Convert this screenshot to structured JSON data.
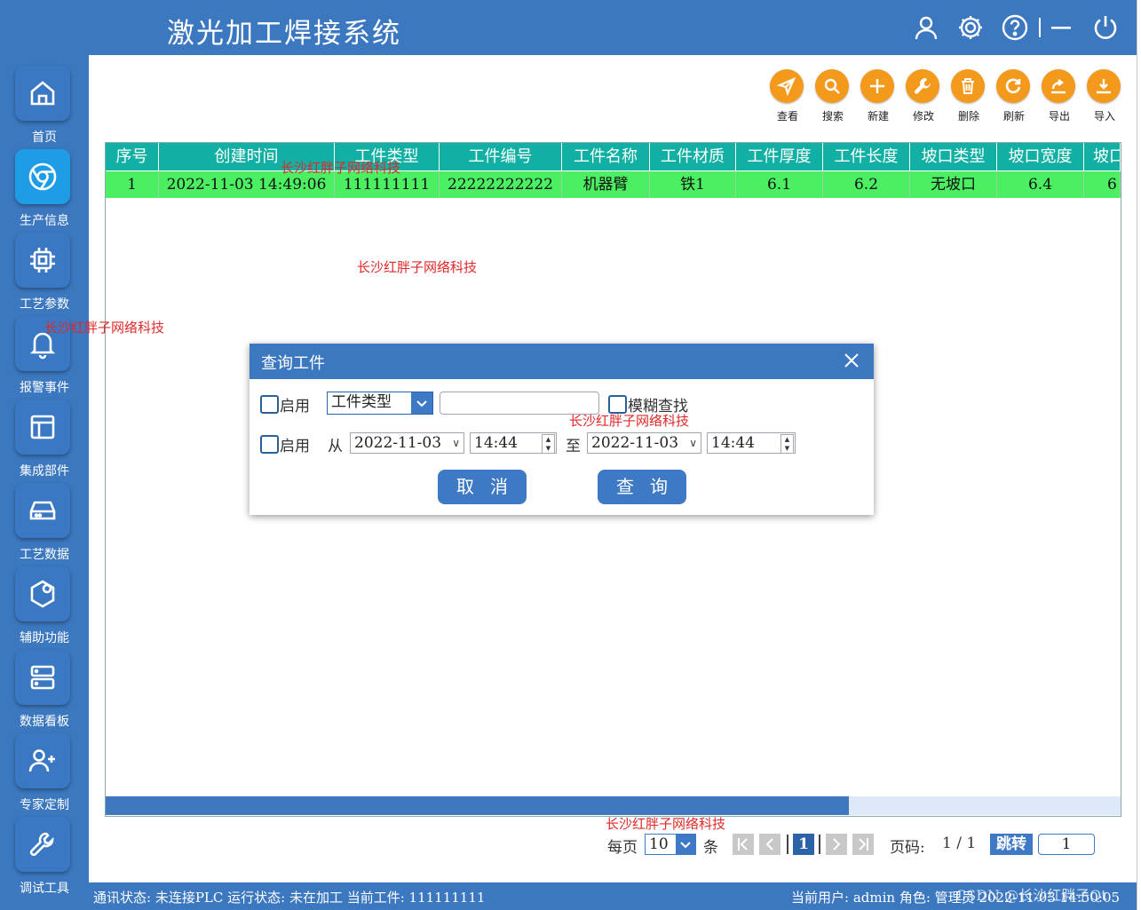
{
  "app": {
    "title": "激光加工焊接系统"
  },
  "titlebar_icons": [
    "user-icon",
    "gear-icon",
    "help-icon",
    "minimize-icon",
    "power-icon"
  ],
  "sidebar": {
    "items": [
      {
        "label": "首页",
        "icon": "home-icon",
        "active": false
      },
      {
        "label": "生产信息",
        "icon": "chrome-icon",
        "active": true
      },
      {
        "label": "工艺参数",
        "icon": "chip-icon",
        "active": false
      },
      {
        "label": "报警事件",
        "icon": "bell-icon",
        "active": false
      },
      {
        "label": "集成部件",
        "icon": "layout-icon",
        "active": false
      },
      {
        "label": "工艺数据",
        "icon": "drive-icon",
        "active": false
      },
      {
        "label": "辅助功能",
        "icon": "hexagon-icon",
        "active": false
      },
      {
        "label": "数据看板",
        "icon": "server-icon",
        "active": false
      },
      {
        "label": "专家定制",
        "icon": "user-plus-icon",
        "active": false
      },
      {
        "label": "调试工具",
        "icon": "wrench-icon",
        "active": false
      }
    ]
  },
  "toolbar": {
    "buttons": [
      {
        "label": "查看",
        "icon": "send-icon"
      },
      {
        "label": "搜索",
        "icon": "search-icon"
      },
      {
        "label": "新建",
        "icon": "plus-icon"
      },
      {
        "label": "修改",
        "icon": "wrench-icon"
      },
      {
        "label": "删除",
        "icon": "trash-icon"
      },
      {
        "label": "刷新",
        "icon": "refresh-icon"
      },
      {
        "label": "导出",
        "icon": "export-icon"
      },
      {
        "label": "导入",
        "icon": "import-icon"
      }
    ]
  },
  "table": {
    "columns": [
      "序号",
      "创建时间",
      "工件类型",
      "工件编号",
      "工件名称",
      "工件材质",
      "工件厚度",
      "工件长度",
      "坡口类型",
      "坡口宽度",
      "坡口"
    ],
    "rows": [
      [
        "1",
        "2022-11-03 14:49:06",
        "111111111",
        "22222222222",
        "机器臂",
        "铁1",
        "6.1",
        "6.2",
        "无坡口",
        "6.4",
        "6"
      ]
    ]
  },
  "watermarks": [
    "长沙红胖子网络科技",
    "长沙红胖子网络科技",
    "长沙红胖子网络科技",
    "长沙红胖子网络科技",
    "长沙红胖子网络科技"
  ],
  "dialog": {
    "title": "查询工件",
    "row1": {
      "enable_label": "启用",
      "type_select": "工件类型",
      "keyword_value": "",
      "fuzzy_label": "模糊查找"
    },
    "row2": {
      "enable_label": "启用",
      "from_label": "从",
      "from_date": "2022-11-03",
      "from_time": "14:44",
      "to_label": "至",
      "to_date": "2022-11-03",
      "to_time": "14:44"
    },
    "cancel_label": "取消",
    "query_label": "查询"
  },
  "pager": {
    "per_page_label": "每页",
    "per_page_value": "10",
    "unit_label": "条",
    "current_page": "1",
    "page_label": "页码:",
    "page_info": "1 / 1",
    "jump_label": "跳转",
    "jump_value": "1"
  },
  "status": {
    "left": "通讯状态: 未连接PLC 运行状态: 未在加工 当前工件: 111111111",
    "right": "当前用户: admin 角色: 管理员 2022-11-03 14:50:05",
    "csdn": "CSDN @长沙红胖子Qt"
  }
}
